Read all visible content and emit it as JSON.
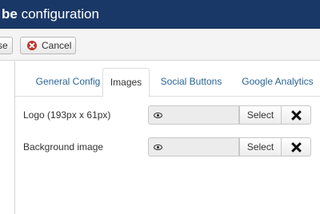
{
  "window": {
    "title_bold": "be",
    "title_rest": " configuration"
  },
  "toolbar": {
    "close_label": "se",
    "cancel_label": "Cancel"
  },
  "tabs": [
    {
      "label": "General Config",
      "active": false
    },
    {
      "label": "Images",
      "active": true
    },
    {
      "label": "Social Buttons",
      "active": false
    },
    {
      "label": "Google Analytics",
      "active": false
    }
  ],
  "fields": [
    {
      "label": "Logo (193px x 61px)",
      "value": "",
      "select_label": "Select"
    },
    {
      "label": "Background image",
      "value": "",
      "select_label": "Select"
    }
  ],
  "colors": {
    "titlebar": "#1a3867",
    "link": "#2a6496",
    "cancel_icon": "#c0352b"
  }
}
